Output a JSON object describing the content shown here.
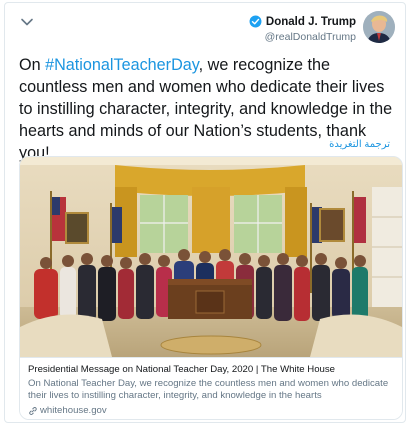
{
  "tweet": {
    "author": {
      "display_name": "Donald J. Trump",
      "handle": "@realDonaldTrump",
      "verified": true
    },
    "text_prefix": "On ",
    "hashtag": "#NationalTeacherDay",
    "text_suffix": ", we recognize the countless men and women who dedicate their lives to instilling character, integrity, and knowledge in the hearts and minds of our Nation’s students, thank you!",
    "translate_label": "ترجمة التغريدة"
  },
  "link_card": {
    "title": "Presidential Message on National Teacher Day, 2020 | The White House",
    "description": "On National Teacher Day, we recognize the countless men and women who dedicate their lives to instilling character, integrity, and knowledge in the hearts",
    "domain": "whitehouse.gov"
  },
  "colors": {
    "link_blue": "#1b95e0",
    "verified_blue": "#1da1f2",
    "muted_gray": "#657786",
    "border": "#e1e8ed"
  },
  "icons": {
    "caret": "chevron-down-icon",
    "verified": "verified-badge-icon",
    "link": "link-icon"
  }
}
